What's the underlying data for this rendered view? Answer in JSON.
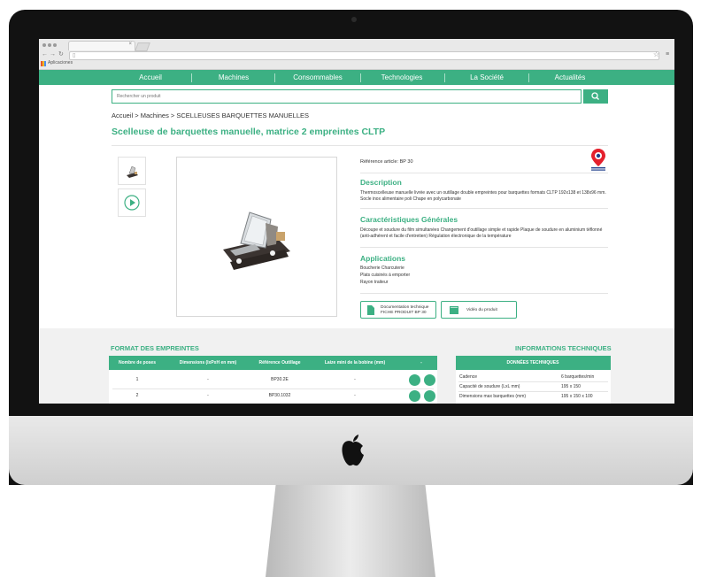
{
  "browser": {
    "bookmarks_label": "Aplicaciones"
  },
  "nav": {
    "items": [
      "Accueil",
      "Machines",
      "Consommables",
      "Technologies",
      "La Société",
      "Actualités"
    ]
  },
  "search": {
    "placeholder": "Rechercher un produit"
  },
  "breadcrumb": "Accueil > Machines > SCELLEUSES BARQUETTES MANUELLES",
  "product": {
    "title": "Scelleuse de barquettes manuelle, matrice 2 empreintes CLTP",
    "reference": "Référence article: BP 30",
    "description_heading": "Description",
    "description_text": "Thermoscelleuse manuelle livrée avec un outillage double empreintes pour barquettes formats CLTP 192x138 et 138x96 mm. Socle inox alimentaire poli Chape en polycarbonate",
    "features_heading": "Caractéristiques Générales",
    "features_text": "Découpe et soudure du film simultanées Changement d'outillage simple et rapide Plaque de soudure en aluminium téflonné (anti-adhérent et facile d'entretien) Régulation électronique de la température",
    "applications_heading": "Applications",
    "applications": [
      "Boucherie Charcuterie",
      "Plats cuisinés à emporter",
      "Rayon traiteur"
    ],
    "doc_button_line1": "Documentation technique",
    "doc_button_line2": "FICHE PRODUIT BP 30",
    "video_button_label": "Vidéo du produit"
  },
  "formats": {
    "title": "FORMAT DES EMPREINTES",
    "headers": [
      "Nombre de poses",
      "Dimensions (lxPxH en mm)",
      "Référence Outillage",
      "Laize mini de la bobine (mm)",
      "-"
    ],
    "rows": [
      [
        "1",
        "-",
        "BP30.2E",
        "-"
      ],
      [
        "2",
        "-",
        "BP30.1032",
        "-"
      ]
    ]
  },
  "tech_info": {
    "title": "INFORMATIONS TECHNIQUES",
    "header": "DONNÉES TECHNIQUES",
    "rows": [
      [
        "Cadence",
        "6 barquettes/min"
      ],
      [
        "Capacité de soudure (LxL mm)",
        "195 x 150"
      ],
      [
        "Dimensions max barquettes (mm)",
        "195 x 150 x 100"
      ]
    ]
  },
  "colors": {
    "brand_green": "#3cb083"
  }
}
